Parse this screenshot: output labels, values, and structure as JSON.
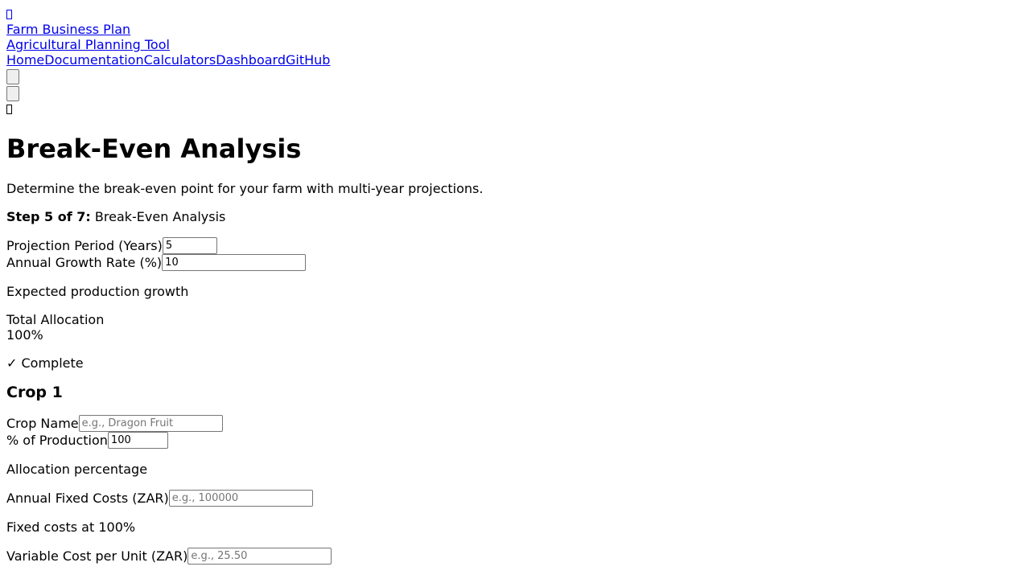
{
  "header": {
    "brand_title": "Farm Business Plan",
    "brand_subtitle": "Agricultural Planning Tool",
    "nav": [
      "Home",
      "Documentation",
      "Calculators",
      "Dashboard",
      "GitHub"
    ]
  },
  "icons": {
    "top_link": "menu-icon",
    "top_glyph": "leaf-icon",
    "menu_toggle": "toggle-icon",
    "theme_toggle": "theme-icon",
    "calculator": "calculator-icon"
  },
  "page": {
    "title": "Break-Even Analysis",
    "description": "Determine the break-even point for your farm with multi-year projections.",
    "step_label": "Step 5 of 7:",
    "step_name": " Break-Even Analysis"
  },
  "projection": {
    "period_label": "Projection Period (Years)",
    "period_value": "5",
    "growth_label": "Annual Growth Rate (%)",
    "growth_value": "10",
    "growth_help": "Expected production growth"
  },
  "allocation": {
    "label": "Total Allocation",
    "value": "100%",
    "status": "✓ Complete"
  },
  "crop": {
    "heading": "Crop 1",
    "name_label": "Crop Name",
    "name_placeholder": "e.g., Dragon Fruit",
    "production_label": "% of Production",
    "production_value": "100",
    "production_help": "Allocation percentage",
    "fixed_label": "Annual Fixed Costs (ZAR)",
    "fixed_placeholder": "e.g., 100000",
    "fixed_help": "Fixed costs at 100%",
    "variable_label": "Variable Cost per Unit (ZAR)",
    "variable_placeholder": "e.g., 25.50"
  }
}
